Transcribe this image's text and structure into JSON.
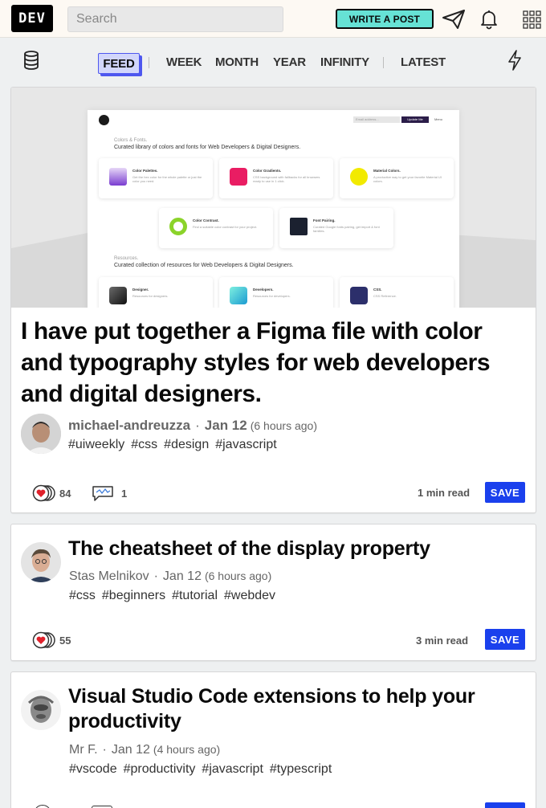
{
  "header": {
    "logo": "DEV",
    "search_placeholder": "Search",
    "write_post": "WRITE A POST",
    "icons": [
      "send-icon",
      "bell-icon",
      "apps-grid-icon"
    ]
  },
  "nav": {
    "tabs": [
      {
        "label": "FEED",
        "active": true
      },
      {
        "label": "WEEK"
      },
      {
        "label": "MONTH"
      },
      {
        "label": "YEAR"
      },
      {
        "label": "INFINITY"
      },
      {
        "label": "LATEST"
      }
    ],
    "icons": [
      "database-icon",
      "lightning-icon"
    ]
  },
  "posts": [
    {
      "title": "I have put together a Figma file with color and typography styles for web developers and digital designers.",
      "author": "michael-andreuzza",
      "date": "Jan 12",
      "ago": "(6 hours ago)",
      "tags": [
        "#uiweekly",
        "#css",
        "#design",
        "#javascript"
      ],
      "reactions": "84",
      "comments": "1",
      "read_time": "1 min read",
      "save": "SAVE",
      "cover": {
        "section1": "Colors & Fonts.",
        "section1_desc": "Curated library of colors and fonts for Web Developers & Digital Designers.",
        "section2": "Resources.",
        "section2_desc": "Curated collection of resources for Web Developers & Digital Designers.",
        "nav_input": "Email address...",
        "nav_button": "Update Me",
        "nav_menu": "Menu",
        "tiles": [
          {
            "name": "Color Palettes.",
            "desc": "Get the hex color for the whole palette or just the color you need."
          },
          {
            "name": "Color Gradients.",
            "desc": "CSS background with fallbacks for all browsers ready to use in 1 click."
          },
          {
            "name": "Material Colors.",
            "desc": "A productive way to get your favorite Material UI colors."
          },
          {
            "name": "Color Contrast.",
            "desc": "Find a suitable color contrast for your project."
          },
          {
            "name": "Font Pairing.",
            "desc": "Curated Google fonts pairing, get import & font families."
          },
          {
            "name": "Designer.",
            "desc": "Resources for designers."
          },
          {
            "name": "Developers.",
            "desc": "Resources for developers."
          },
          {
            "name": "CSS.",
            "desc": "CSS Reference."
          }
        ]
      }
    },
    {
      "title": "The cheatsheet of the display property",
      "author": "Stas Melnikov",
      "date": "Jan 12",
      "ago": "(6 hours ago)",
      "tags": [
        "#css",
        "#beginners",
        "#tutorial",
        "#webdev"
      ],
      "reactions": "55",
      "read_time": "3 min read",
      "save": "SAVE"
    },
    {
      "title": "Visual Studio Code extensions to help your productivity",
      "author": "Mr F.",
      "date": "Jan 12",
      "ago": "(4 hours ago)",
      "tags": [
        "#vscode",
        "#productivity",
        "#javascript",
        "#typescript"
      ]
    }
  ],
  "colors": {
    "accent": "#66e2d5",
    "save": "#1a40ed",
    "feed_active": "#d2d6fb",
    "feed_border": "#4e57ef",
    "heart": "#e0212b"
  }
}
